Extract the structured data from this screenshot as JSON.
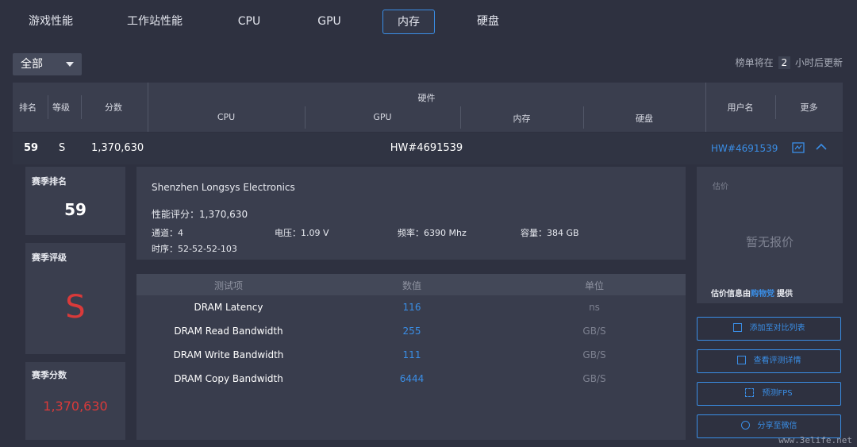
{
  "tabs": [
    "游戏性能",
    "工作站性能",
    "CPU",
    "GPU",
    "内存",
    "硬盘"
  ],
  "filter": {
    "selected": "全部"
  },
  "update": {
    "prefix": "榜单将在",
    "hours": "2",
    "suffix": "小时后更新"
  },
  "table": {
    "headers": {
      "rank": "排名",
      "grade": "等级",
      "score": "分数",
      "hardware": "硬件",
      "cpu": "CPU",
      "gpu": "GPU",
      "memory": "内存",
      "disk": "硬盘",
      "user": "用户名",
      "more": "更多"
    },
    "row": {
      "rank": "59",
      "grade": "S",
      "score": "1,370,630",
      "hardware_id": "HW#4691539",
      "user": "HW#4691539"
    }
  },
  "season": {
    "rank_label": "赛季排名",
    "rank": "59",
    "grade_label": "赛季评级",
    "grade": "S",
    "score_label": "赛季分数",
    "score": "1,370,630"
  },
  "memory_info": {
    "maker": "Shenzhen Longsys Electronics",
    "perf": "性能评分：1,370,630",
    "channels": "通道：4",
    "voltage": "电压：1.09 V",
    "frequency": "频率：6390 Mhz",
    "capacity": "容量：384 GB",
    "timing": "时序：52-52-52-103"
  },
  "tests": {
    "headers": {
      "item": "测试项",
      "value": "数值",
      "unit": "单位"
    },
    "rows": [
      {
        "name": "DRAM Latency",
        "value": "116",
        "unit": "ns"
      },
      {
        "name": "DRAM Read Bandwidth",
        "value": "255",
        "unit": "GB/S"
      },
      {
        "name": "DRAM Write Bandwidth",
        "value": "111",
        "unit": "GB/S"
      },
      {
        "name": "DRAM Copy Bandwidth",
        "value": "6444",
        "unit": "GB/S"
      }
    ]
  },
  "price": {
    "label": "估价",
    "empty": "暂无报价",
    "source_prefix": "估价信息由",
    "source_name": "购物党",
    "source_suffix": "提供"
  },
  "actions": [
    "添加至对比列表",
    "查看评测详情",
    "预测FPS",
    "分享至微信"
  ],
  "watermark": "www.3elife.net",
  "colors": {
    "accent": "#3a8ee6",
    "grade_red": "#d93a3a",
    "bg": "#2e3140",
    "panel": "#3a3e4e"
  }
}
